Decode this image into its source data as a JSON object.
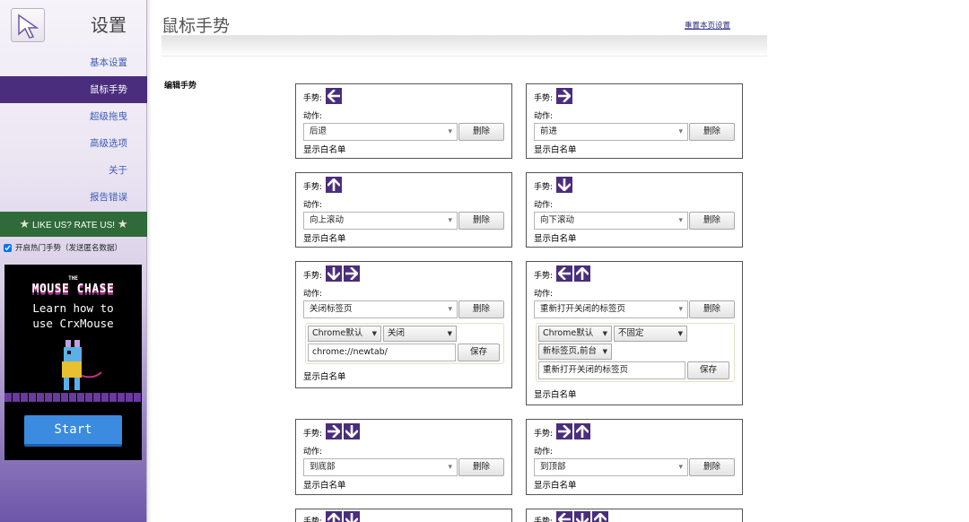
{
  "sidebar": {
    "title": "设置",
    "nav": [
      "基本设置",
      "鼠标手势",
      "超级拖曳",
      "高级选项",
      "关于",
      "报告错误"
    ],
    "active_index": 1,
    "rate_banner": "LIKE US? RATE US!",
    "hot_gestures_label": "开启热门手势（发送匿名数据）",
    "hot_gestures_checked": true,
    "promo": {
      "the": "THE",
      "title": "MOUSE CHASE",
      "line1": "Learn how to",
      "line2": "use CrxMouse",
      "start": "Start"
    }
  },
  "header": {
    "title": "鼠标手势",
    "reset_link": "重置本页设置"
  },
  "section_label": "编辑手势",
  "labels": {
    "gesture": "手势:",
    "action": "动作:",
    "delete": "删除",
    "whitelist": "显示白名单",
    "save": "保存"
  },
  "cards": [
    {
      "gesture": [
        "left"
      ],
      "action": "后退"
    },
    {
      "gesture": [
        "right"
      ],
      "action": "前进"
    },
    {
      "gesture": [
        "up"
      ],
      "action": "向上滚动"
    },
    {
      "gesture": [
        "down"
      ],
      "action": "向下滚动"
    },
    {
      "gesture": [
        "down",
        "right"
      ],
      "action": "关闭标签页",
      "options": {
        "dd1": "Chrome默认",
        "dd2": "关闭",
        "input": "chrome://newtab/"
      }
    },
    {
      "gesture": [
        "left",
        "up"
      ],
      "action": "重新打开关闭的标签页",
      "options": {
        "dd1": "Chrome默认",
        "dd2": "不固定",
        "dd3": "新标签页,前台",
        "input": "重新打开关闭的标签页"
      }
    },
    {
      "gesture": [
        "right",
        "down"
      ],
      "action": "到底部"
    },
    {
      "gesture": [
        "right",
        "up"
      ],
      "action": "到顶部"
    },
    {
      "gesture": [
        "up",
        "down"
      ],
      "action": ""
    },
    {
      "gesture": [
        "left",
        "down",
        "up"
      ],
      "action": ""
    }
  ],
  "colors": {
    "accent": "#4a2e7d",
    "nav_link": "#3b5cb8",
    "rate_banner": "#2f6b3a"
  }
}
